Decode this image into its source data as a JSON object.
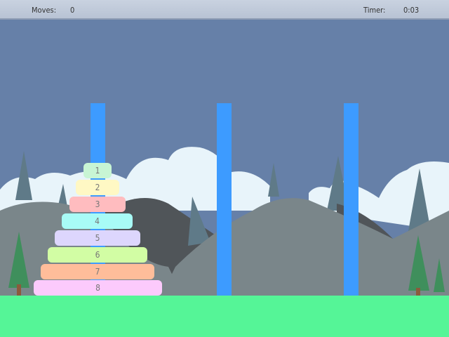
{
  "hud": {
    "moves_label": "Moves:",
    "moves_value": "0",
    "timer_label": "Timer:",
    "timer_value": "0:03"
  },
  "pegs": 3,
  "disks": [
    {
      "label": "1",
      "color": "#c8f5d4"
    },
    {
      "label": "2",
      "color": "#fff8c4"
    },
    {
      "label": "3",
      "color": "#ffbcbf"
    },
    {
      "label": "4",
      "color": "#a8fbf6"
    },
    {
      "label": "5",
      "color": "#ddd6fd"
    },
    {
      "label": "6",
      "color": "#d2fda4"
    },
    {
      "label": "7",
      "color": "#ffbd9a"
    },
    {
      "label": "8",
      "color": "#fccafc"
    }
  ],
  "colors": {
    "sky": "#6680a8",
    "peg": "#3d9bff",
    "ground": "#55f597"
  }
}
